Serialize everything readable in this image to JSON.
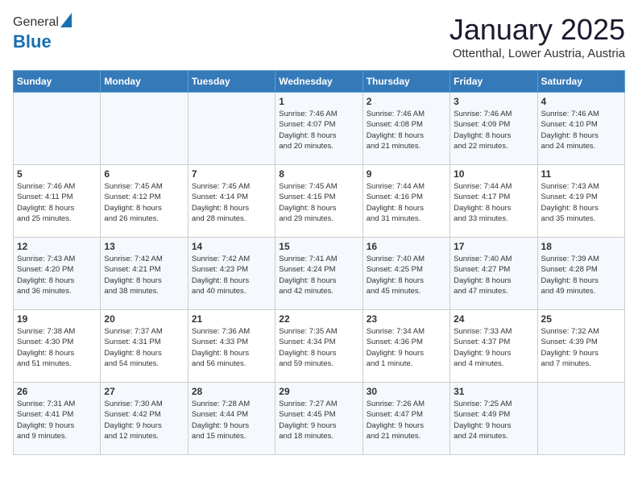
{
  "logo": {
    "general": "General",
    "blue": "Blue"
  },
  "title": {
    "month": "January 2025",
    "location": "Ottenthal, Lower Austria, Austria"
  },
  "weekdays": [
    "Sunday",
    "Monday",
    "Tuesday",
    "Wednesday",
    "Thursday",
    "Friday",
    "Saturday"
  ],
  "weeks": [
    [
      {
        "day": "",
        "content": ""
      },
      {
        "day": "",
        "content": ""
      },
      {
        "day": "",
        "content": ""
      },
      {
        "day": "1",
        "content": "Sunrise: 7:46 AM\nSunset: 4:07 PM\nDaylight: 8 hours\nand 20 minutes."
      },
      {
        "day": "2",
        "content": "Sunrise: 7:46 AM\nSunset: 4:08 PM\nDaylight: 8 hours\nand 21 minutes."
      },
      {
        "day": "3",
        "content": "Sunrise: 7:46 AM\nSunset: 4:09 PM\nDaylight: 8 hours\nand 22 minutes."
      },
      {
        "day": "4",
        "content": "Sunrise: 7:46 AM\nSunset: 4:10 PM\nDaylight: 8 hours\nand 24 minutes."
      }
    ],
    [
      {
        "day": "5",
        "content": "Sunrise: 7:46 AM\nSunset: 4:11 PM\nDaylight: 8 hours\nand 25 minutes."
      },
      {
        "day": "6",
        "content": "Sunrise: 7:45 AM\nSunset: 4:12 PM\nDaylight: 8 hours\nand 26 minutes."
      },
      {
        "day": "7",
        "content": "Sunrise: 7:45 AM\nSunset: 4:14 PM\nDaylight: 8 hours\nand 28 minutes."
      },
      {
        "day": "8",
        "content": "Sunrise: 7:45 AM\nSunset: 4:15 PM\nDaylight: 8 hours\nand 29 minutes."
      },
      {
        "day": "9",
        "content": "Sunrise: 7:44 AM\nSunset: 4:16 PM\nDaylight: 8 hours\nand 31 minutes."
      },
      {
        "day": "10",
        "content": "Sunrise: 7:44 AM\nSunset: 4:17 PM\nDaylight: 8 hours\nand 33 minutes."
      },
      {
        "day": "11",
        "content": "Sunrise: 7:43 AM\nSunset: 4:19 PM\nDaylight: 8 hours\nand 35 minutes."
      }
    ],
    [
      {
        "day": "12",
        "content": "Sunrise: 7:43 AM\nSunset: 4:20 PM\nDaylight: 8 hours\nand 36 minutes."
      },
      {
        "day": "13",
        "content": "Sunrise: 7:42 AM\nSunset: 4:21 PM\nDaylight: 8 hours\nand 38 minutes."
      },
      {
        "day": "14",
        "content": "Sunrise: 7:42 AM\nSunset: 4:23 PM\nDaylight: 8 hours\nand 40 minutes."
      },
      {
        "day": "15",
        "content": "Sunrise: 7:41 AM\nSunset: 4:24 PM\nDaylight: 8 hours\nand 42 minutes."
      },
      {
        "day": "16",
        "content": "Sunrise: 7:40 AM\nSunset: 4:25 PM\nDaylight: 8 hours\nand 45 minutes."
      },
      {
        "day": "17",
        "content": "Sunrise: 7:40 AM\nSunset: 4:27 PM\nDaylight: 8 hours\nand 47 minutes."
      },
      {
        "day": "18",
        "content": "Sunrise: 7:39 AM\nSunset: 4:28 PM\nDaylight: 8 hours\nand 49 minutes."
      }
    ],
    [
      {
        "day": "19",
        "content": "Sunrise: 7:38 AM\nSunset: 4:30 PM\nDaylight: 8 hours\nand 51 minutes."
      },
      {
        "day": "20",
        "content": "Sunrise: 7:37 AM\nSunset: 4:31 PM\nDaylight: 8 hours\nand 54 minutes."
      },
      {
        "day": "21",
        "content": "Sunrise: 7:36 AM\nSunset: 4:33 PM\nDaylight: 8 hours\nand 56 minutes."
      },
      {
        "day": "22",
        "content": "Sunrise: 7:35 AM\nSunset: 4:34 PM\nDaylight: 8 hours\nand 59 minutes."
      },
      {
        "day": "23",
        "content": "Sunrise: 7:34 AM\nSunset: 4:36 PM\nDaylight: 9 hours\nand 1 minute."
      },
      {
        "day": "24",
        "content": "Sunrise: 7:33 AM\nSunset: 4:37 PM\nDaylight: 9 hours\nand 4 minutes."
      },
      {
        "day": "25",
        "content": "Sunrise: 7:32 AM\nSunset: 4:39 PM\nDaylight: 9 hours\nand 7 minutes."
      }
    ],
    [
      {
        "day": "26",
        "content": "Sunrise: 7:31 AM\nSunset: 4:41 PM\nDaylight: 9 hours\nand 9 minutes."
      },
      {
        "day": "27",
        "content": "Sunrise: 7:30 AM\nSunset: 4:42 PM\nDaylight: 9 hours\nand 12 minutes."
      },
      {
        "day": "28",
        "content": "Sunrise: 7:28 AM\nSunset: 4:44 PM\nDaylight: 9 hours\nand 15 minutes."
      },
      {
        "day": "29",
        "content": "Sunrise: 7:27 AM\nSunset: 4:45 PM\nDaylight: 9 hours\nand 18 minutes."
      },
      {
        "day": "30",
        "content": "Sunrise: 7:26 AM\nSunset: 4:47 PM\nDaylight: 9 hours\nand 21 minutes."
      },
      {
        "day": "31",
        "content": "Sunrise: 7:25 AM\nSunset: 4:49 PM\nDaylight: 9 hours\nand 24 minutes."
      },
      {
        "day": "",
        "content": ""
      }
    ]
  ]
}
